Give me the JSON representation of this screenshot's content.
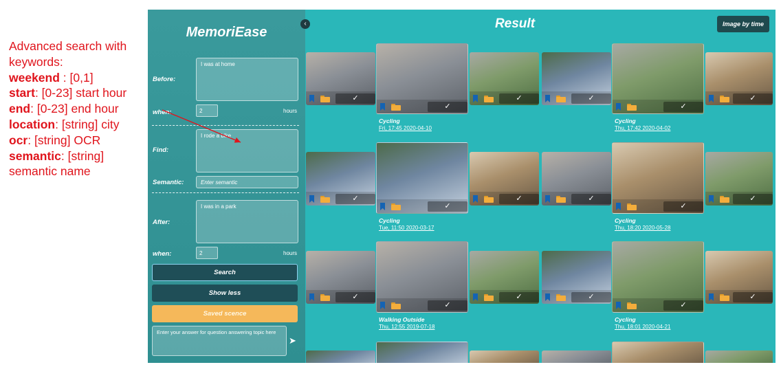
{
  "annotation": {
    "intro": "Advanced search with keywords:",
    "items": [
      {
        "key": "weekend",
        "desc": " : [0,1]"
      },
      {
        "key": "start",
        "desc": ": [0-23] start hour"
      },
      {
        "key": "end",
        "desc": ": [0-23] end hour"
      },
      {
        "key": "location",
        "desc": ": [string] city"
      },
      {
        "key": "ocr",
        "desc": ": [string] OCR"
      },
      {
        "key": "semantic",
        "desc": ": [string] semantic name"
      }
    ],
    "arrow_color": "#e0141c"
  },
  "sidebar": {
    "title": "MemoriEase",
    "before_label": "Before:",
    "before_value": "I was at home",
    "when_label": "when:",
    "before_when_value": "2",
    "hours_label": "hours",
    "find_label": "Find:",
    "find_value": "I rode a bike",
    "semantic_label": "Semantic:",
    "semantic_placeholder": "Enter semantic",
    "after_label": "After:",
    "after_value": "I was in a park",
    "after_when_value": "2",
    "search_button": "Search",
    "show_less_button": "Show less",
    "saved_button": "Saved scence",
    "qa_placeholder": "Enter your answer for question answering topic here",
    "send_icon": "send-icon"
  },
  "result": {
    "title": "Result",
    "image_by_time_button": "Image by time",
    "collapse_icon": "chevron-left-icon",
    "check_glyph": "✓",
    "groups": [
      {
        "label": "Cycling",
        "date": "Fri, 17:45 2020-04-10"
      },
      {
        "label": "Cycling",
        "date": "Thu, 17:42 2020-04-02"
      },
      {
        "label": "Cycling",
        "date": "Tue, 11:50 2020-03-17"
      },
      {
        "label": "Cycling",
        "date": "Thu, 18:20 2020-05-28"
      },
      {
        "label": "Walking Outside",
        "date": "Thu, 12:55 2019-07-18"
      },
      {
        "label": "Cycling",
        "date": "Thu, 18:01 2020-04-21"
      }
    ]
  },
  "colors": {
    "sidebar_bg": "#3a9a9c",
    "result_bg": "#2ab7b9",
    "button_dark": "#1f4e57",
    "saved_button": "#f5b85a",
    "bookmark": "#1463b3",
    "folder": "#f3ad3c"
  }
}
